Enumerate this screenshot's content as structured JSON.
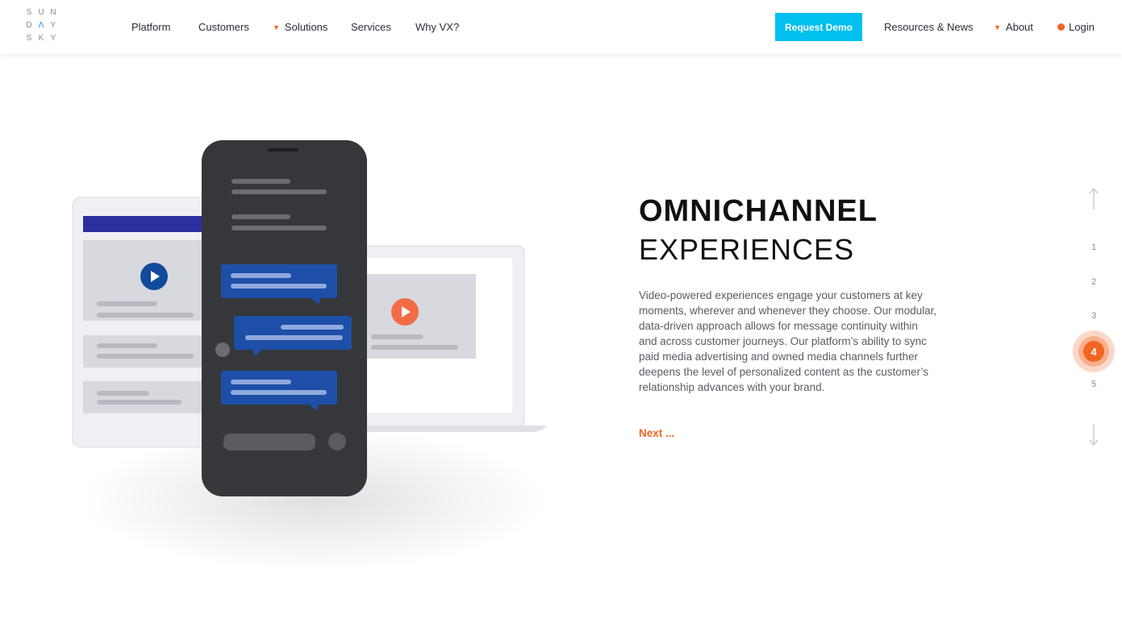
{
  "logo": {
    "rows": [
      [
        "S",
        "U",
        "N"
      ],
      [
        "D",
        "Λ",
        "Y"
      ],
      [
        "S",
        "K",
        "Y"
      ]
    ]
  },
  "nav": {
    "platform": "Platform",
    "customers": "Customers",
    "solutions": "Solutions",
    "services": "Services",
    "why_vx": "Why VX?",
    "request_demo": "Request Demo",
    "resources": "Resources & News",
    "about": "About",
    "login": "Login"
  },
  "hero": {
    "title_bold": "OMNICHANNEL",
    "title_light": "EXPERIENCES",
    "body": "Video-powered experiences engage your customers at key moments, wherever and whenever they choose. Our modular, data-driven approach allows for message continuity within and across customer journeys. Our platform’s ability to sync paid media advertising and owned media channels further deepens the level of personalized content as the customer’s relationship advances with your brand.",
    "next": "Next ..."
  },
  "pager": {
    "pages": [
      "1",
      "2",
      "3",
      "4",
      "5"
    ],
    "current": "4"
  },
  "colors": {
    "accent": "#f26522",
    "cta": "#00c0f0",
    "chat_bubble": "#1e4fa8",
    "phone": "#35373b",
    "play_blue": "#134b9c"
  }
}
